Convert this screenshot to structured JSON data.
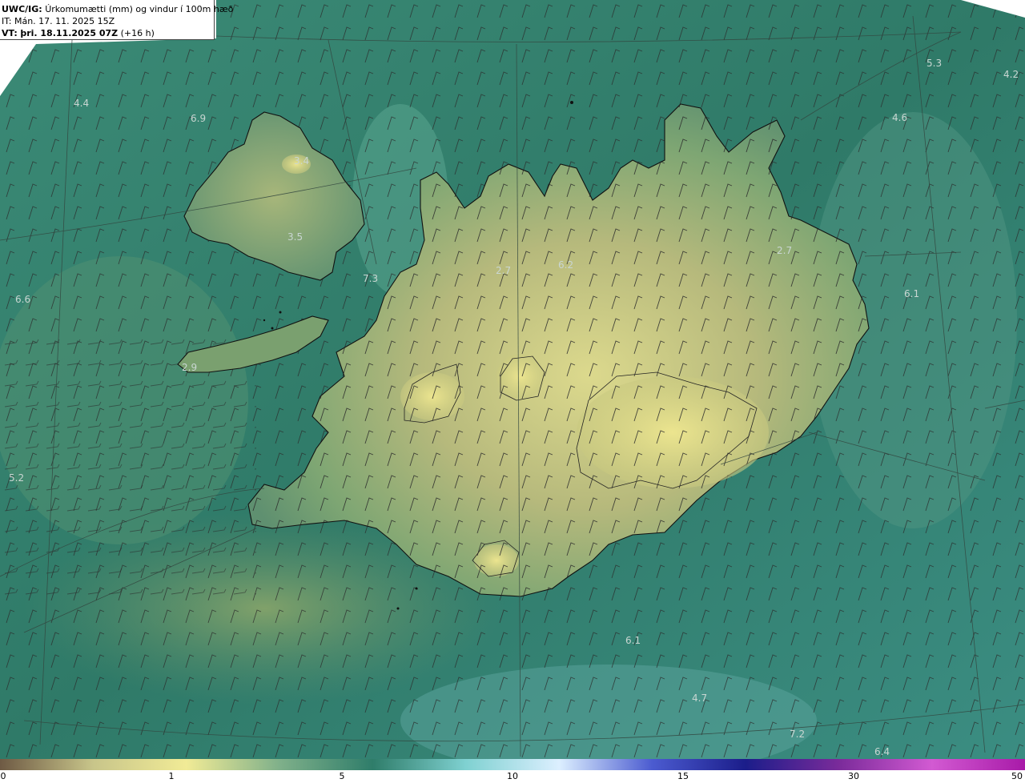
{
  "title": {
    "model": "UWC/IG:",
    "description": "Úrkomumætti (mm) og vindur í 100m hæð",
    "initial_time": "IT: Mán. 17. 11. 2025 15Z",
    "valid_prefix": "VT:",
    "valid_time": "þri. 18.11.2025 07Z",
    "lead_time": "(+16 h)"
  },
  "map_labels": [
    {
      "text": "4.4"
    },
    {
      "text": "6.9"
    },
    {
      "text": "3.4"
    },
    {
      "text": "3.5"
    },
    {
      "text": "7.3"
    },
    {
      "text": "6.6"
    },
    {
      "text": "2.9"
    },
    {
      "text": "5.2"
    },
    {
      "text": "2.7"
    },
    {
      "text": "6.2"
    },
    {
      "text": "2.7"
    },
    {
      "text": "5.3"
    },
    {
      "text": "4.2"
    },
    {
      "text": "4.6"
    },
    {
      "text": "6.1"
    },
    {
      "text": "6.1"
    },
    {
      "text": "4.7"
    },
    {
      "text": "7.2"
    },
    {
      "text": "6.4"
    }
  ],
  "colorbar": {
    "ticks": [
      "0",
      "1",
      "5",
      "10",
      "15",
      "30",
      "50"
    ],
    "colors": [
      "#6e5a44",
      "#c8c58a",
      "#f1eb96",
      "#7fb08a",
      "#2f7d6a",
      "#7fd1d1",
      "#dcefff",
      "#4b5bd0",
      "#1b1d8a",
      "#7a2b9a",
      "#d25ad2",
      "#a81aa8"
    ]
  },
  "colors": {
    "sea_dark": "#2f7566",
    "sea_mid": "#3e8a78",
    "land_low": "#6f9b6e",
    "land_high": "#d9d88c",
    "coast": "#101010",
    "grid": "#3a4a44"
  }
}
